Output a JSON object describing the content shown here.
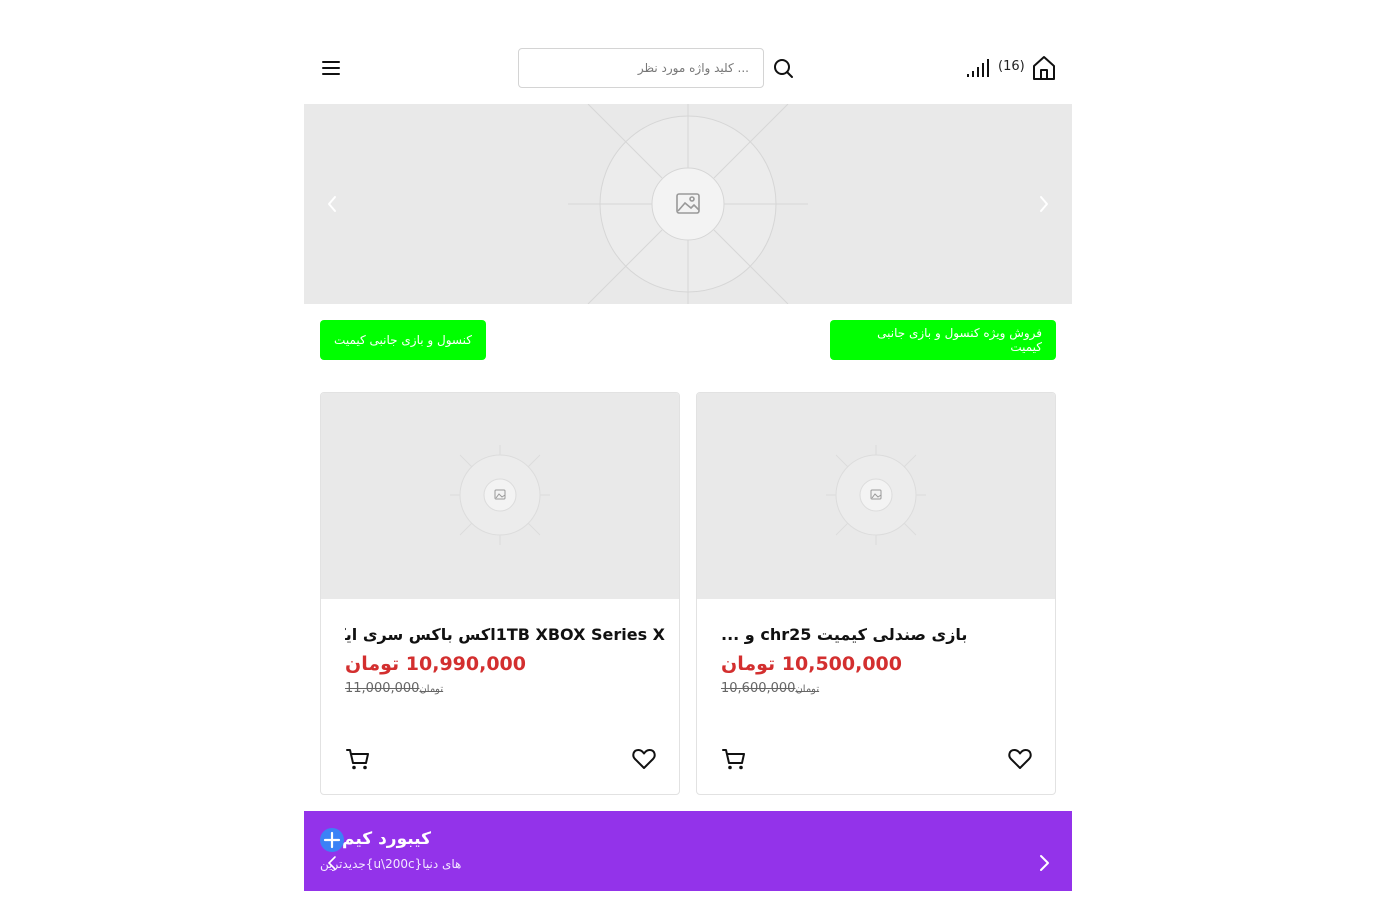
{
  "header": {
    "search_placeholder": "... کلید واژه مورد نظر",
    "count": "(16)"
  },
  "tags": {
    "left": "کنسول و بازی جانبی کیمیت",
    "right": "فروش ویژه کنسول و بازی جانبی کیمیت"
  },
  "products": [
    {
      "title": "1TB XBOX Series Xاکس باکس سری ایکس",
      "price": "10,990,000 تومان",
      "old_price": "11,000,000",
      "old_currency": "تومان"
    },
    {
      "title": "بازی صندلی کیمیت chr25 و ...",
      "price": "10,500,000 تومان",
      "old_price": "10,600,000",
      "old_currency": "تومان"
    }
  ],
  "banner": {
    "title": "کیبورد کیم",
    "subtitle": "های دنیا{u\\200c}جدیدترین"
  },
  "colors": {
    "accent_green": "#00ff00",
    "price_red": "#d32f2f",
    "banner_purple": "#9333ea",
    "plus_blue": "#3b82f6"
  },
  "icons": [
    "menu-icon",
    "search-icon",
    "signal-icon",
    "home-icon",
    "chevron-left-icon",
    "chevron-right-icon",
    "image-placeholder-icon",
    "cart-icon",
    "heart-icon",
    "plus-icon"
  ]
}
